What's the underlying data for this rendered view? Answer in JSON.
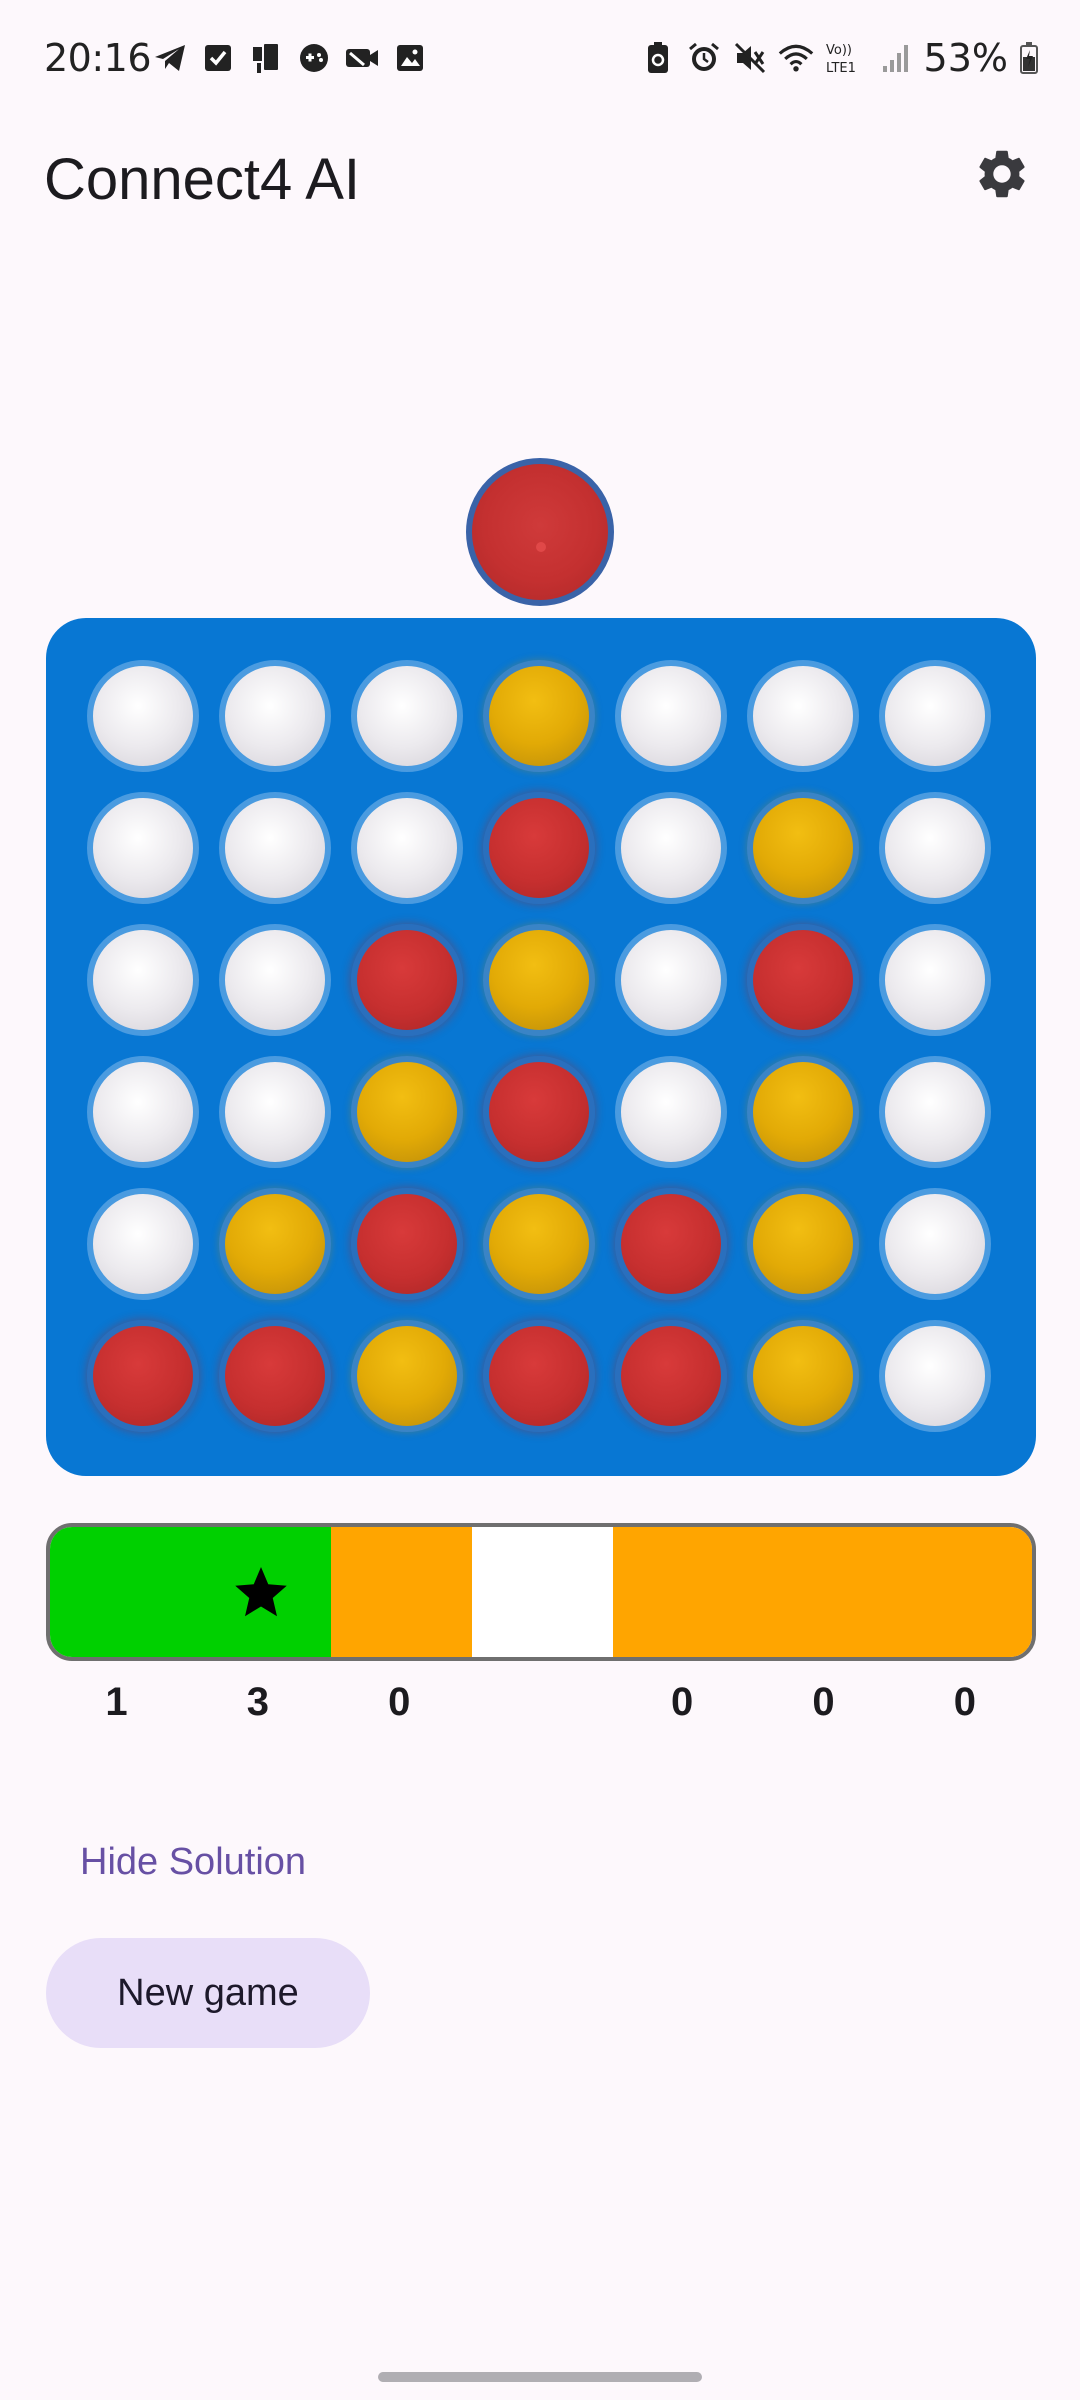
{
  "status_bar": {
    "time": "20:16",
    "battery": "53%",
    "left_icons": [
      "telegram-icon",
      "checkbox-icon",
      "device-icon",
      "game-icon",
      "camera-off-icon",
      "image-icon"
    ],
    "right_icons": [
      "battery-saver-icon",
      "alarm-icon",
      "mute-icon",
      "wifi-icon",
      "volte-icon",
      "signal-icon",
      "battery-icon"
    ],
    "volte_label": "Vo)) LTE1"
  },
  "app_bar": {
    "title": "Connect4 AI",
    "settings_icon": "gear-icon"
  },
  "drop_disc": {
    "color": "red"
  },
  "board": {
    "rows": 6,
    "cols": 7,
    "colors": {
      "board": "#0877d3",
      "red": "#c62f2f",
      "yellow": "#e2aa06",
      "empty": "#eceaee"
    },
    "cells": [
      [
        "empty",
        "empty",
        "empty",
        "yellow",
        "empty",
        "empty",
        "empty"
      ],
      [
        "empty",
        "empty",
        "empty",
        "red",
        "empty",
        "yellow",
        "empty"
      ],
      [
        "empty",
        "empty",
        "red",
        "yellow",
        "empty",
        "red",
        "empty"
      ],
      [
        "empty",
        "empty",
        "yellow",
        "red",
        "empty",
        "yellow",
        "empty"
      ],
      [
        "empty",
        "yellow",
        "red",
        "yellow",
        "red",
        "yellow",
        "empty"
      ],
      [
        "red",
        "red",
        "yellow",
        "red",
        "red",
        "yellow",
        "empty"
      ]
    ]
  },
  "evaluation": {
    "segments": [
      "green",
      "green",
      "orange",
      "white",
      "orange",
      "orange",
      "orange"
    ],
    "best_column_index": 1,
    "scores": [
      "1",
      "3",
      "0",
      "",
      "0",
      "0",
      "0"
    ],
    "colors": {
      "green": "#00d000",
      "orange": "#ffa500",
      "white": "#ffffff"
    }
  },
  "buttons": {
    "hide_solution": "Hide Solution",
    "new_game": "New game"
  }
}
